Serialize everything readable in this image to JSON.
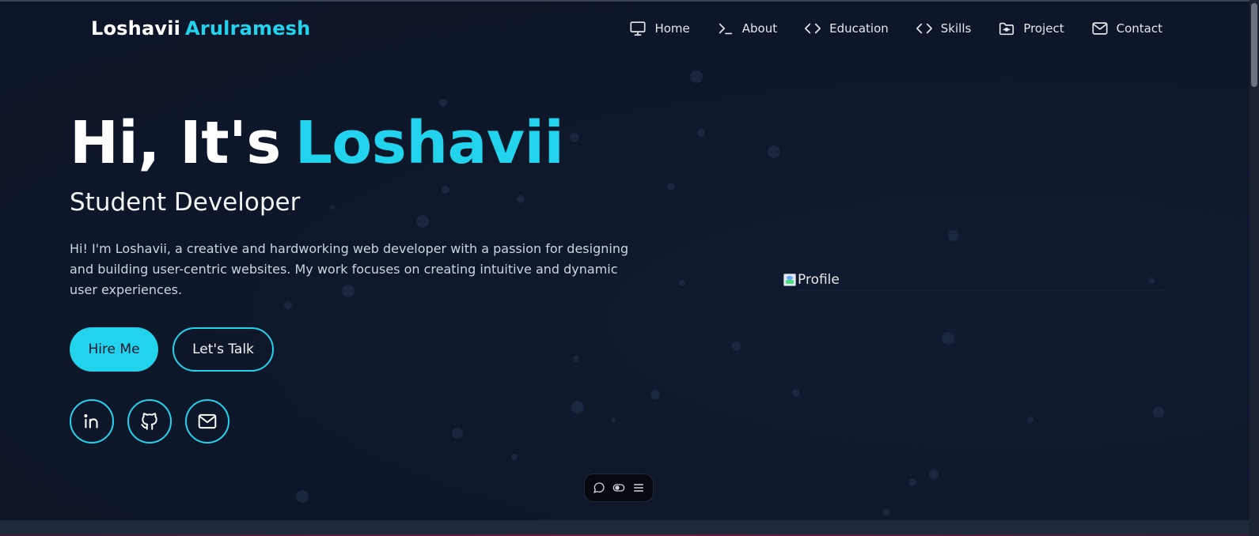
{
  "brand": {
    "first": "Loshavii",
    "last": "Arulramesh"
  },
  "nav": {
    "items": [
      {
        "label": "Home",
        "icon": "monitor-icon"
      },
      {
        "label": "About",
        "icon": "terminal-icon"
      },
      {
        "label": "Education",
        "icon": "code-icon"
      },
      {
        "label": "Skills",
        "icon": "code-icon"
      },
      {
        "label": "Project",
        "icon": "folder-icon"
      },
      {
        "label": "Contact",
        "icon": "mail-icon"
      }
    ]
  },
  "hero": {
    "greeting": "Hi, It's",
    "name": "Loshavii",
    "role": "Student Developer",
    "description": "Hi! I'm Loshavii, a creative and hardworking web developer with a passion for designing and building user-centric websites. My work focuses on creating intuitive and dynamic user experiences.",
    "hire_label": "Hire Me",
    "talk_label": "Let's Talk"
  },
  "social": [
    {
      "name": "linkedin-icon"
    },
    {
      "name": "github-icon"
    },
    {
      "name": "mail-icon"
    }
  ],
  "profile": {
    "alt": "Profile"
  },
  "toolbar": {
    "icons": [
      "chat-icon",
      "toggle-icon",
      "menu-icon"
    ]
  },
  "colors": {
    "accent": "#22d3ee",
    "background": "#0f172a",
    "text": "#ffffff"
  }
}
